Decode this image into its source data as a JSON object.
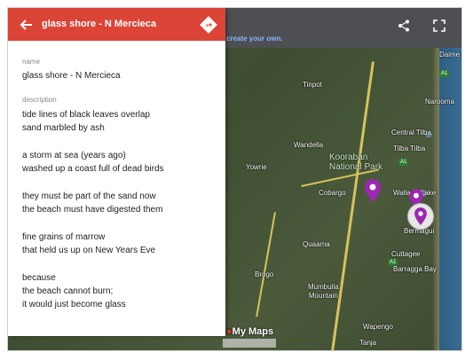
{
  "panel": {
    "title": "glass shore - N Mercieca",
    "name_label": "name",
    "name_value": "glass shore - N Mercieca",
    "description_label": "description",
    "stanzas": [
      [
        "tide lines of black leaves overlap",
        "sand marbled by ash"
      ],
      [
        "a storm at sea (years ago)",
        "washed up a coast full of dead birds"
      ],
      [
        "they must be part of the sand now",
        "the beach must have digested them"
      ],
      [
        "fine grains of marrow",
        "that held us up on New Years Eve"
      ],
      [
        "because",
        "the beach cannot burn;",
        "it would just become glass"
      ]
    ]
  },
  "map": {
    "hint_text": "create your own.",
    "logo_text": "My Maps",
    "places": {
      "daime": "Daime",
      "tinpot": "Tinpot",
      "narooma": "Narooma",
      "central_tilba": "Central Tilba",
      "tilba_tilba": "Tilba Tilba",
      "wandella": "Wandella",
      "yowrie": "Yowrie",
      "cobargo": "Cobargo",
      "wallaga_lake": "Wallaga Lake",
      "bermagui": "Bermagui",
      "quaama": "Quaama",
      "cuttagee": "Cuttagee",
      "barragga_bay": "Barragga Bay",
      "brogo": "Brogo",
      "mumbulla_mountain": "Mumbulla\nMountain",
      "wapengo": "Wapengo",
      "tanja": "Tanja"
    },
    "park_label_1": "Kooraban",
    "park_label_2": "National Park",
    "road_shields": [
      "A1",
      "A1",
      "A1"
    ]
  },
  "colors": {
    "header": "#db4437",
    "pin": "#9c27b0"
  }
}
